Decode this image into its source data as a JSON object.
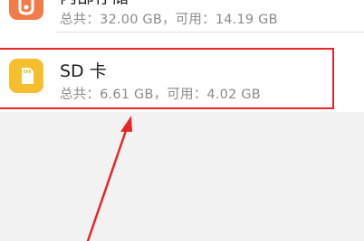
{
  "storage": {
    "internal": {
      "title": "内部存储",
      "total_label": "总共：",
      "total_value": "32.00 GB",
      "separator": "，",
      "available_label": "可用：",
      "available_value": "14.19 GB",
      "icon": "internal-storage-icon",
      "icon_color": "#f07c4a"
    },
    "sd_card": {
      "title": "SD 卡",
      "total_label": "总共：",
      "total_value": "6.61 GB",
      "separator": "，",
      "available_label": "可用：",
      "available_value": "4.02 GB",
      "icon": "sd-card-icon",
      "icon_color": "#f5be2e"
    }
  },
  "annotation": {
    "highlight_color": "#e8262a"
  }
}
